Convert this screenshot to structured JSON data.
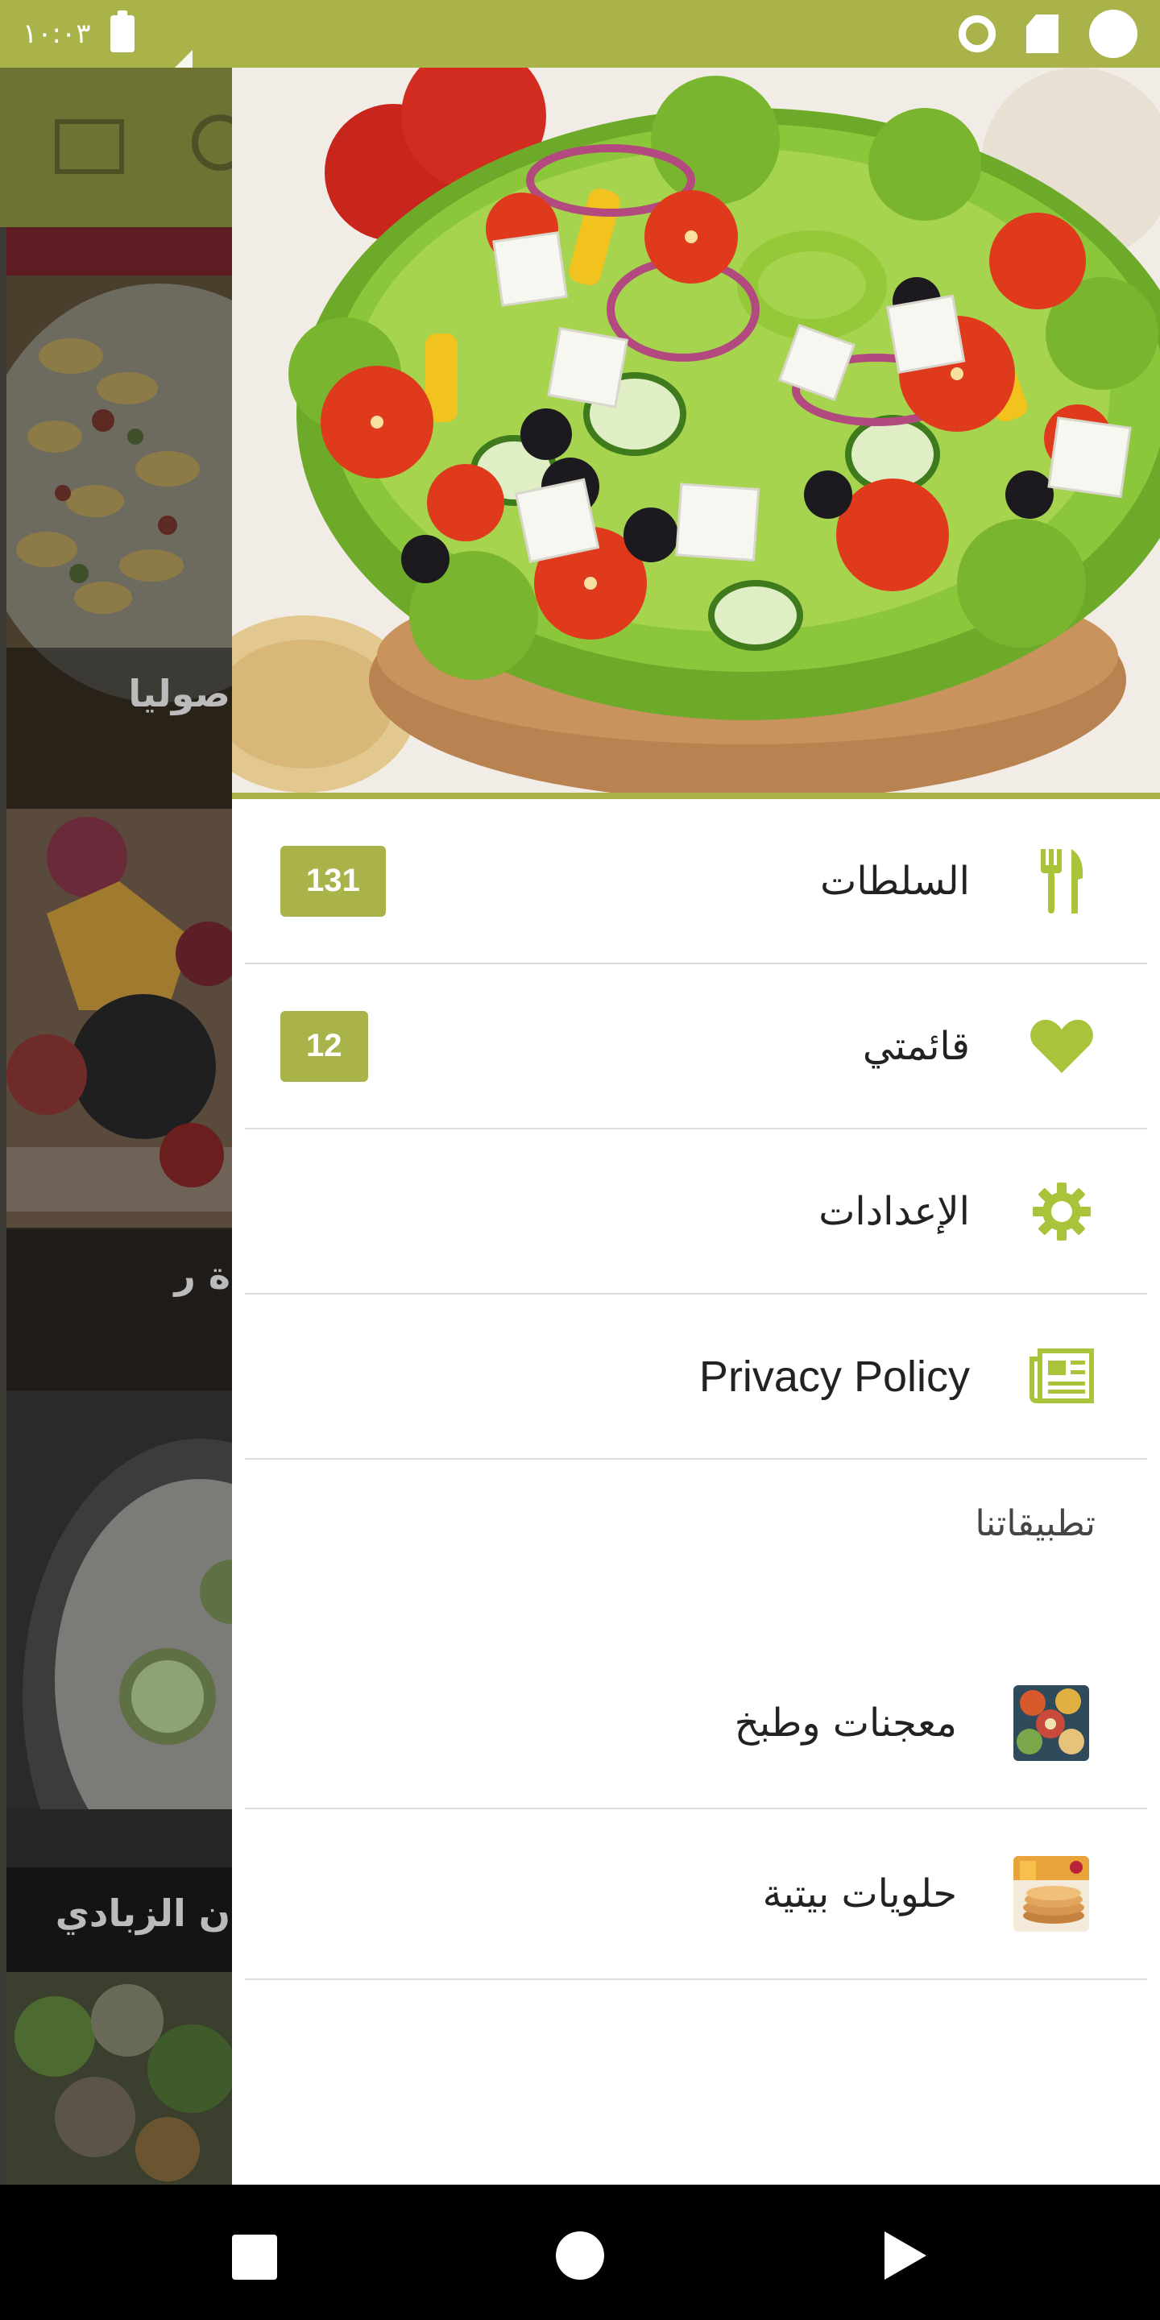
{
  "status_bar": {
    "time": "١٠:٠٣",
    "icons": [
      "battery-icon",
      "no-signal-icon",
      "sync-ring-icon",
      "sd-card-icon",
      "notification-dot-icon"
    ]
  },
  "background_app": {
    "cards": [
      {
        "caption": "صوليا"
      },
      {
        "caption": "ة ر"
      },
      {
        "caption": "ن الزبادي"
      }
    ],
    "icons": [
      "collections-icon",
      "search-icon"
    ]
  },
  "drawer": {
    "hero_image": "salad-bowl-image",
    "menu": [
      {
        "label": "السلطات",
        "icon": "cutlery-icon",
        "badge": "131"
      },
      {
        "label": "قائمتي",
        "icon": "heart-icon",
        "badge": "12"
      },
      {
        "label": "الإعدادات",
        "icon": "gear-icon",
        "badge": ""
      },
      {
        "label": "Privacy Policy",
        "icon": "newspaper-icon",
        "badge": ""
      }
    ],
    "our_apps_title": "تطبيقاتنا",
    "apps": [
      {
        "label": "معجنات وطبخ",
        "icon": "pastries-app-icon"
      },
      {
        "label": "حلويات بيتية",
        "icon": "sweets-app-icon"
      }
    ]
  },
  "colors": {
    "accent": "#a9b34a",
    "icon_green": "#a9c43a"
  },
  "nav_bar": {
    "buttons": [
      "recents-button",
      "home-button",
      "back-button"
    ]
  }
}
